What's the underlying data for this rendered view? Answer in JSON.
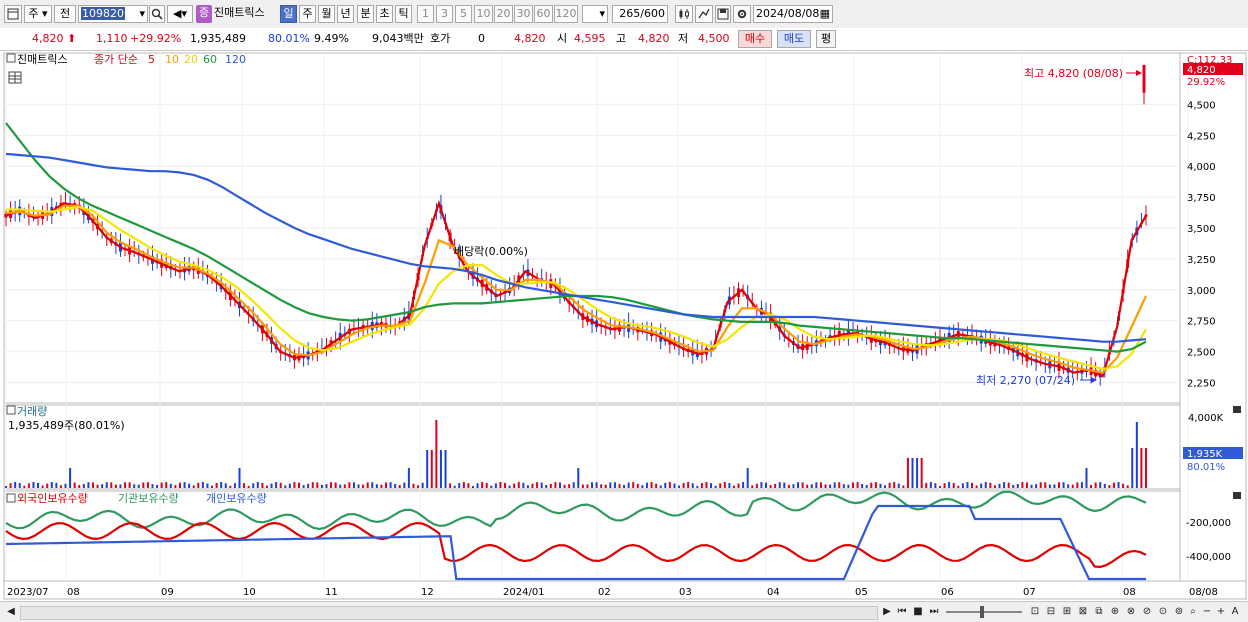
{
  "toolbar": {
    "market_select": "주",
    "prev_label": "전",
    "code_value": "109820",
    "stock_name": "진매트릭스",
    "badge": "증",
    "periods": [
      "일",
      "주",
      "월",
      "년",
      "분",
      "초",
      "틱"
    ],
    "intervals": [
      "1",
      "3",
      "5",
      "10",
      "20",
      "30",
      "60",
      "120"
    ],
    "count_value": "265",
    "count_total": "/600",
    "date_value": "2024/08/08"
  },
  "quote": {
    "price": "4,820",
    "change": "1,110",
    "change_pct": "+29.92%",
    "volume": "1,935,489",
    "vol_ratio": "80.01%",
    "turnover": "9.49%",
    "amount": "9,043백만",
    "hoga_label": "호가",
    "hoga_value": "0",
    "hoga_price": "4,820",
    "open_label": "시",
    "open_value": "4,595",
    "high_label": "고",
    "high_value": "4,820",
    "low_label": "저",
    "low_value": "4,500",
    "buy_label": "매수",
    "sell_label": "매도",
    "eval_label": "평"
  },
  "panels": {
    "price_title": "진매트릭스",
    "ma_label": "종가 단순",
    "ma_periods": [
      "5",
      "10",
      "20",
      "60",
      "120"
    ],
    "volume_title": "거래량",
    "volume_info": "1,935,489주(80.01%)",
    "holding_series": [
      "외국인보유수량",
      "기관보유수량",
      "개인보유수량"
    ]
  },
  "annotations": {
    "high": "최고 4,820 (08/08)",
    "low": "최저 2,270 (07/24)",
    "dividend": "배당락(0.00%)",
    "price_tag": "4,820",
    "pct_tag": "29.92%",
    "cutoff_tag": "C:112.33",
    "vol_tag": "1,935K",
    "vol_pct_tag": "80.01%"
  },
  "colors": {
    "up": "#e0001b",
    "down": "#1b3fd8",
    "ma5": "#e00000",
    "ma10": "#ff9c00",
    "ma20": "#f5e600",
    "ma60": "#1c9a3c",
    "ma120": "#2f5bd8",
    "foreign": "#e00000",
    "institution": "#2f9a5f",
    "individual": "#2f5bd8"
  },
  "chart_data": {
    "type": "line",
    "price_axis_ticks": [
      "4,500",
      "4,250",
      "4,000",
      "3,750",
      "3,500",
      "3,250",
      "3,000",
      "2,750",
      "2,500",
      "2,250"
    ],
    "price_ylim": [
      2100,
      4900
    ],
    "volume_axis_ticks": [
      "4,000K"
    ],
    "holding_axis_ticks": [
      "-200,000",
      "-400,000"
    ],
    "x_labels": [
      "2023/07",
      "08",
      "09",
      "10",
      "11",
      "12",
      "2024/01",
      "02",
      "03",
      "04",
      "05",
      "06",
      "07",
      "08",
      "08/08"
    ],
    "series": [
      {
        "name": "종가 단순 5",
        "values": [
          3600,
          3640,
          3580,
          3620,
          3700,
          3680,
          3560,
          3420,
          3340,
          3300,
          3250,
          3200,
          3150,
          3180,
          3120,
          3020,
          2900,
          2780,
          2650,
          2500,
          2450,
          2470,
          2520,
          2600,
          2680,
          2700,
          2720,
          2700,
          2800,
          3350,
          3700,
          3350,
          3150,
          3050,
          2950,
          3000,
          3150,
          3080,
          3040,
          2900,
          2780,
          2720,
          2680,
          2700,
          2670,
          2640,
          2580,
          2520,
          2480,
          2520,
          2900,
          3000,
          2850,
          2780,
          2620,
          2530,
          2560,
          2610,
          2640,
          2650,
          2600,
          2570,
          2520,
          2510,
          2560,
          2600,
          2640,
          2620,
          2580,
          2550,
          2500,
          2440,
          2400,
          2380,
          2330,
          2350,
          2300,
          2700,
          3400,
          3600
        ]
      },
      {
        "name": "종가 단순 10",
        "values": [
          3620,
          3630,
          3600,
          3610,
          3680,
          3680,
          3600,
          3460,
          3380,
          3330,
          3270,
          3220,
          3180,
          3180,
          3130,
          3050,
          2940,
          2830,
          2700,
          2560,
          2480,
          2470,
          2500,
          2570,
          2640,
          2690,
          2710,
          2710,
          2750,
          3050,
          3400,
          3350,
          3200,
          3100,
          3000,
          3000,
          3080,
          3080,
          3050,
          2950,
          2840,
          2770,
          2710,
          2700,
          2680,
          2650,
          2600,
          2550,
          2500,
          2510,
          2700,
          2850,
          2850,
          2800,
          2680,
          2580,
          2560,
          2590,
          2620,
          2640,
          2620,
          2590,
          2550,
          2520,
          2540,
          2580,
          2610,
          2620,
          2600,
          2570,
          2530,
          2480,
          2440,
          2410,
          2370,
          2350,
          2330,
          2450,
          2700,
          2950
        ]
      },
      {
        "name": "종가 단순 20",
        "values": [
          3650,
          3650,
          3640,
          3630,
          3650,
          3670,
          3640,
          3560,
          3480,
          3410,
          3340,
          3280,
          3230,
          3200,
          3160,
          3100,
          3020,
          2920,
          2810,
          2690,
          2590,
          2530,
          2510,
          2530,
          2580,
          2630,
          2670,
          2700,
          2720,
          2850,
          3050,
          3150,
          3200,
          3200,
          3120,
          3050,
          3050,
          3060,
          3060,
          3000,
          2920,
          2840,
          2770,
          2730,
          2710,
          2690,
          2660,
          2620,
          2570,
          2540,
          2600,
          2700,
          2780,
          2800,
          2760,
          2680,
          2620,
          2600,
          2610,
          2620,
          2630,
          2610,
          2580,
          2560,
          2550,
          2560,
          2580,
          2600,
          2600,
          2590,
          2560,
          2520,
          2480,
          2450,
          2420,
          2390,
          2360,
          2380,
          2480,
          2680
        ]
      },
      {
        "name": "종가 단순 60",
        "values": [
          4350,
          4200,
          4050,
          3920,
          3820,
          3740,
          3680,
          3630,
          3580,
          3530,
          3480,
          3430,
          3380,
          3330,
          3270,
          3200,
          3130,
          3060,
          2990,
          2920,
          2860,
          2810,
          2780,
          2760,
          2750,
          2760,
          2780,
          2800,
          2820,
          2860,
          2880,
          2890,
          2890,
          2890,
          2900,
          2910,
          2920,
          2930,
          2940,
          2950,
          2950,
          2950,
          2940,
          2920,
          2890,
          2860,
          2830,
          2800,
          2780,
          2760,
          2750,
          2740,
          2740,
          2740,
          2730,
          2710,
          2700,
          2690,
          2680,
          2670,
          2660,
          2650,
          2640,
          2630,
          2620,
          2610,
          2610,
          2600,
          2590,
          2580,
          2570,
          2560,
          2550,
          2540,
          2530,
          2520,
          2510,
          2500,
          2520,
          2580
        ]
      },
      {
        "name": "종가 단순 120",
        "values": [
          4100,
          4090,
          4080,
          4070,
          4050,
          4030,
          4010,
          3990,
          3980,
          3970,
          3960,
          3960,
          3950,
          3930,
          3890,
          3830,
          3760,
          3690,
          3620,
          3560,
          3500,
          3450,
          3410,
          3370,
          3330,
          3300,
          3270,
          3240,
          3210,
          3190,
          3180,
          3170,
          3150,
          3120,
          3080,
          3050,
          3020,
          3000,
          2980,
          2960,
          2940,
          2920,
          2900,
          2880,
          2860,
          2840,
          2820,
          2800,
          2790,
          2780,
          2780,
          2780,
          2780,
          2780,
          2780,
          2780,
          2780,
          2770,
          2760,
          2750,
          2740,
          2730,
          2720,
          2710,
          2700,
          2690,
          2680,
          2670,
          2660,
          2650,
          2640,
          2630,
          2620,
          2610,
          2600,
          2590,
          2580,
          2580,
          2590,
          2600
        ]
      }
    ]
  }
}
